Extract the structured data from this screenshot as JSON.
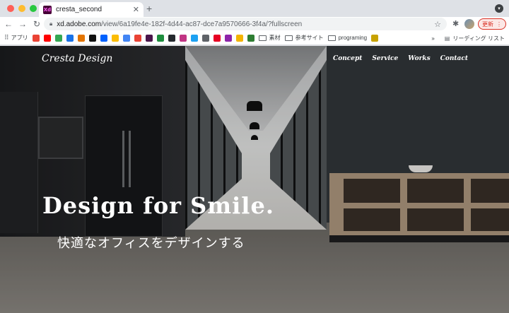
{
  "browser": {
    "tab_title": "cresta_second",
    "tab_icon": "Xd",
    "url_host": "xd.adobe.com",
    "url_path": "/view/6a19fe4e-182f-4d44-ac87-dce7a9570666-3f4a/?fullscreen",
    "update_label": "更新",
    "colors": {
      "close": "#ff5f57",
      "minimize": "#febc2e",
      "maximize": "#28c840",
      "xd_bg": "#470137",
      "update": "#d93025"
    }
  },
  "bookmarks": {
    "apps_label": "アプリ",
    "items": [
      {
        "name": "gmail",
        "color": "#ea4335"
      },
      {
        "name": "youtube",
        "color": "#ff0000"
      },
      {
        "name": "maps",
        "color": "#34a853"
      },
      {
        "name": "site-1",
        "color": "#1a73e8"
      },
      {
        "name": "site-2",
        "color": "#e37400"
      },
      {
        "name": "notion",
        "color": "#111111"
      },
      {
        "name": "dropbox",
        "color": "#0061fe"
      },
      {
        "name": "drive",
        "color": "#fbbc04"
      },
      {
        "name": "site-3",
        "color": "#4285f4"
      },
      {
        "name": "site-4",
        "color": "#ea4335"
      },
      {
        "name": "slack",
        "color": "#4a154b"
      },
      {
        "name": "site-5",
        "color": "#1e8e3e"
      },
      {
        "name": "site-6",
        "color": "#24292e"
      },
      {
        "name": "instagram",
        "color": "#c13584"
      },
      {
        "name": "site-7",
        "color": "#1da1f2"
      },
      {
        "name": "site-8",
        "color": "#5f6368"
      },
      {
        "name": "pinterest",
        "color": "#e60023"
      },
      {
        "name": "site-9",
        "color": "#8e24aa"
      },
      {
        "name": "site-10",
        "color": "#f4b400"
      },
      {
        "name": "site-11",
        "color": "#2e7d32"
      }
    ],
    "folders": [
      "素材",
      "参考サイト",
      "programing"
    ],
    "overflow_label": "»",
    "reading_list_label": "リーディング リスト"
  },
  "site": {
    "brand": "Cresta Design",
    "nav": [
      "Concept",
      "Service",
      "Works",
      "Contact"
    ],
    "headline": "Design for Smile.",
    "subline": "快適なオフィスをデザインする"
  }
}
